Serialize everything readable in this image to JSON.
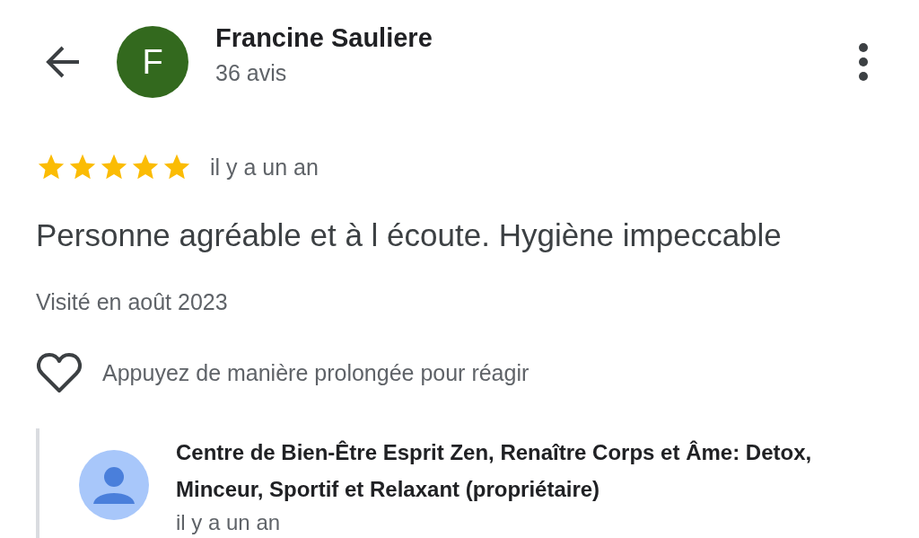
{
  "header": {
    "avatar_letter": "F",
    "name": "Francine Sauliere",
    "review_count": "36 avis"
  },
  "review": {
    "stars": 5,
    "time": "il y a un an",
    "text": "Personne agréable et à l écoute. Hygiène impeccable",
    "visited": "Visité en août 2023",
    "react_hint": "Appuyez de manière prolongée pour réagir"
  },
  "owner_reply": {
    "author": "Centre de Bien-Être Esprit Zen, Renaître Corps et Âme: Detox, Minceur, Sportif et Relaxant (propriétaire)",
    "time": "il y a un an"
  }
}
